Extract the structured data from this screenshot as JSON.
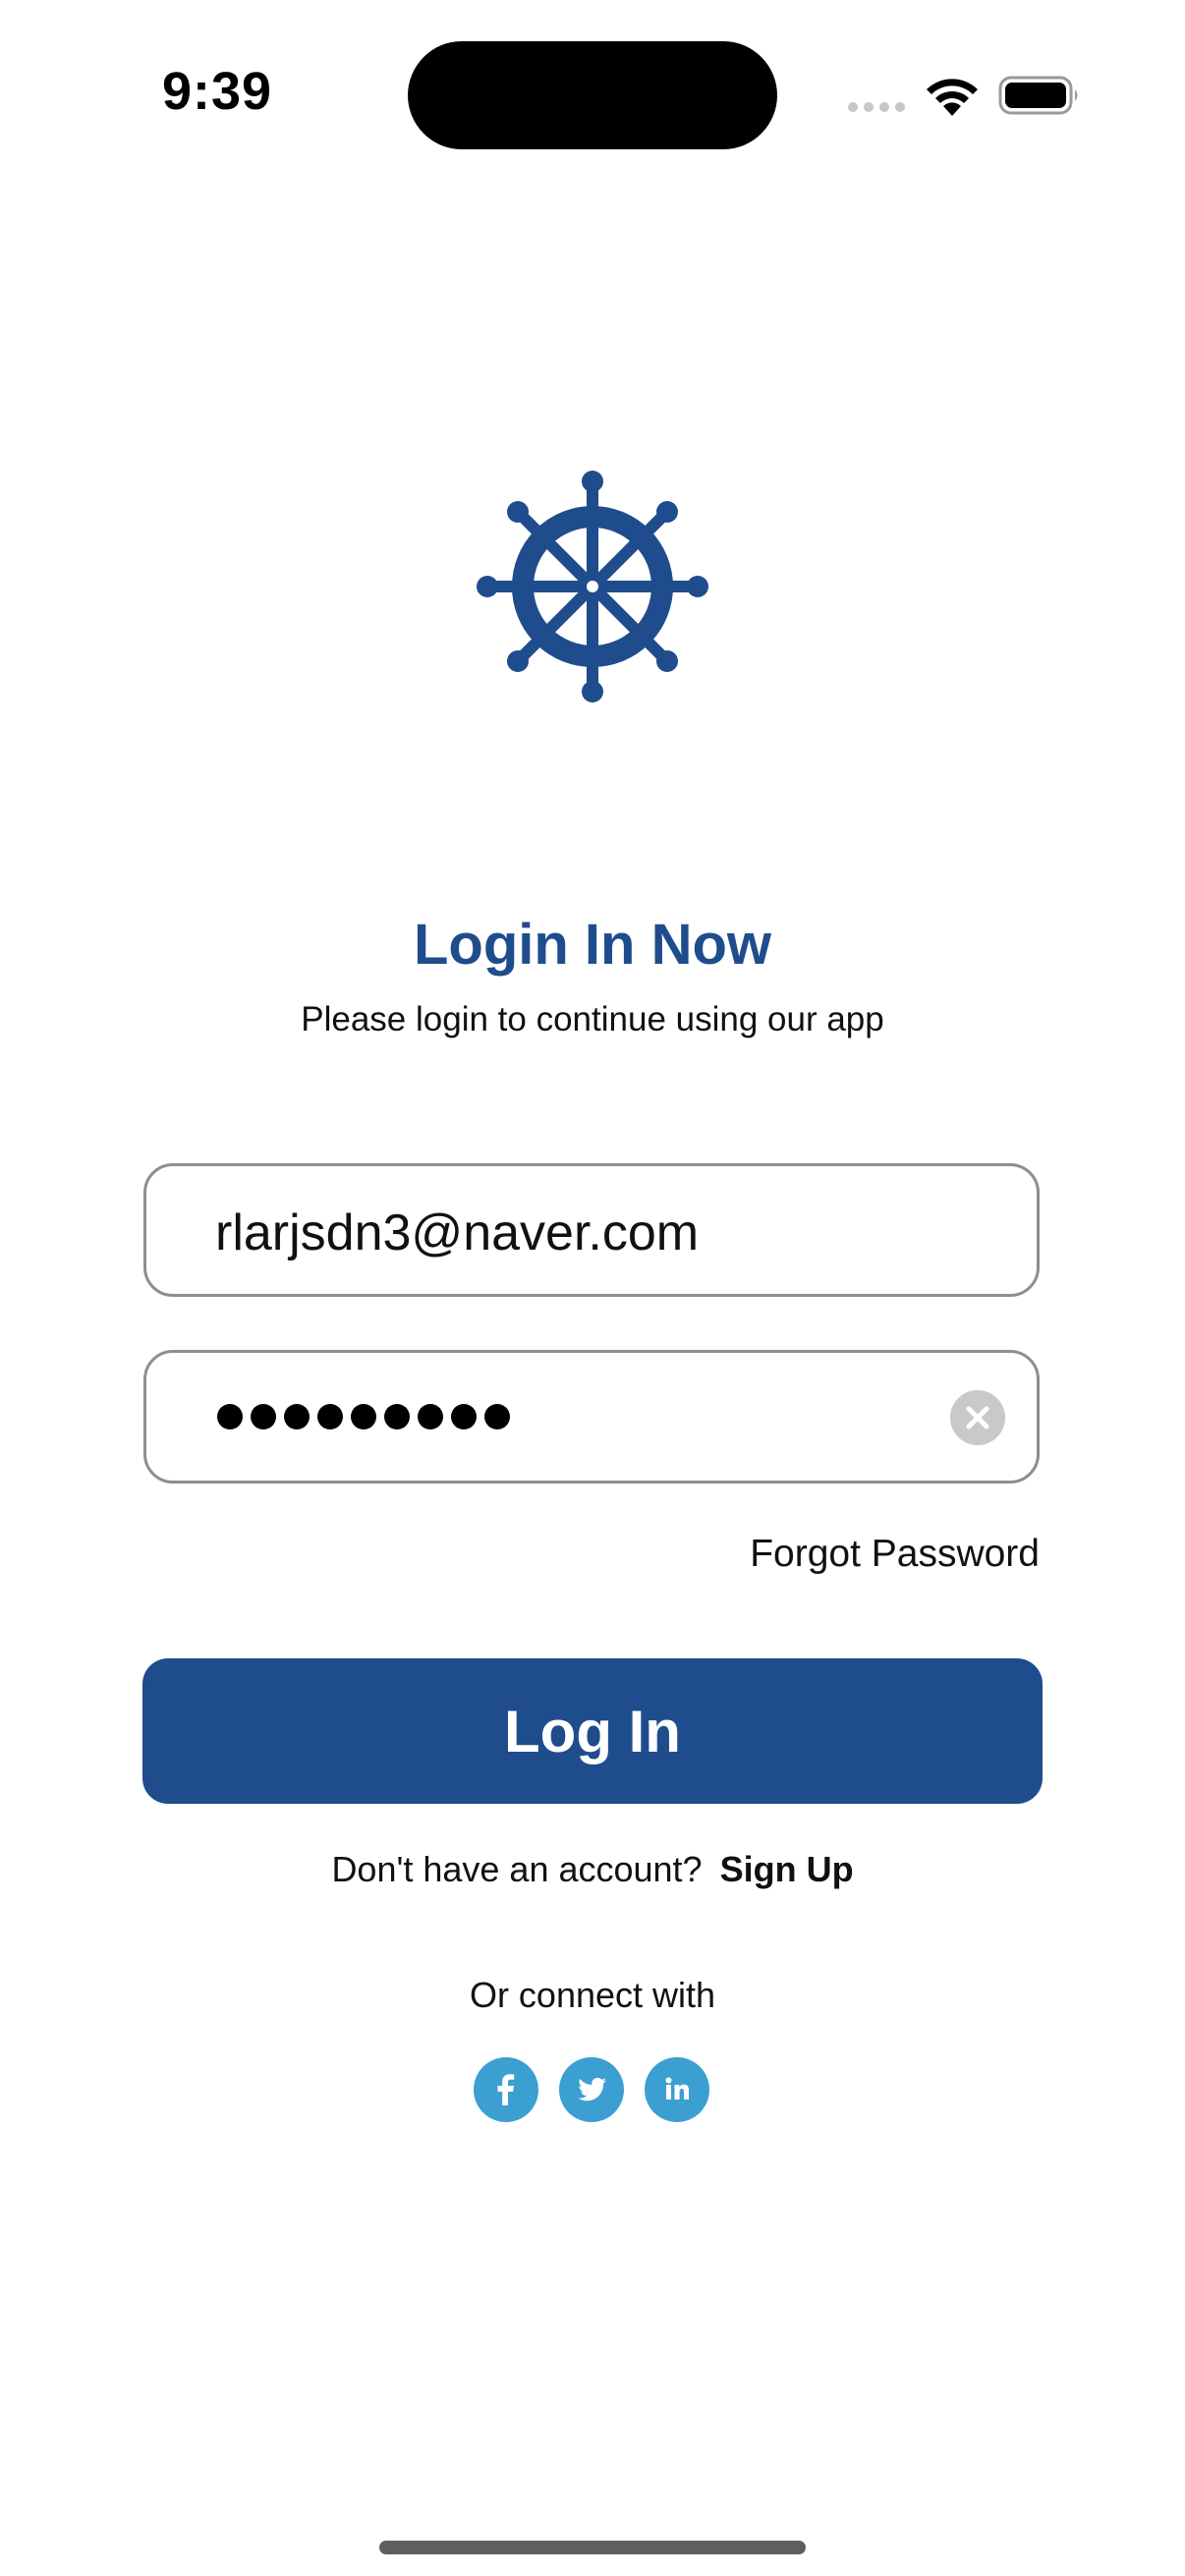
{
  "status_bar": {
    "time": "9:39"
  },
  "logo": {
    "icon": "ship-wheel-icon",
    "color": "#1f4c8c"
  },
  "header": {
    "title": "Login In Now",
    "subtitle": "Please login to continue using our app"
  },
  "form": {
    "email_value": "rlarjsdn3@naver.com",
    "password_mask": "•••••••••",
    "forgot_label": "Forgot Password",
    "login_label": "Log In"
  },
  "signup": {
    "question": "Don't have an account?",
    "link_label": "Sign Up"
  },
  "social": {
    "label": "Or connect with",
    "icons": [
      "facebook-icon",
      "twitter-icon",
      "linkedin-icon"
    ],
    "color": "#3b9fd1"
  },
  "colors": {
    "primary": "#1f4c8c",
    "social": "#3b9fd1",
    "field_border": "#8e8e8e"
  }
}
